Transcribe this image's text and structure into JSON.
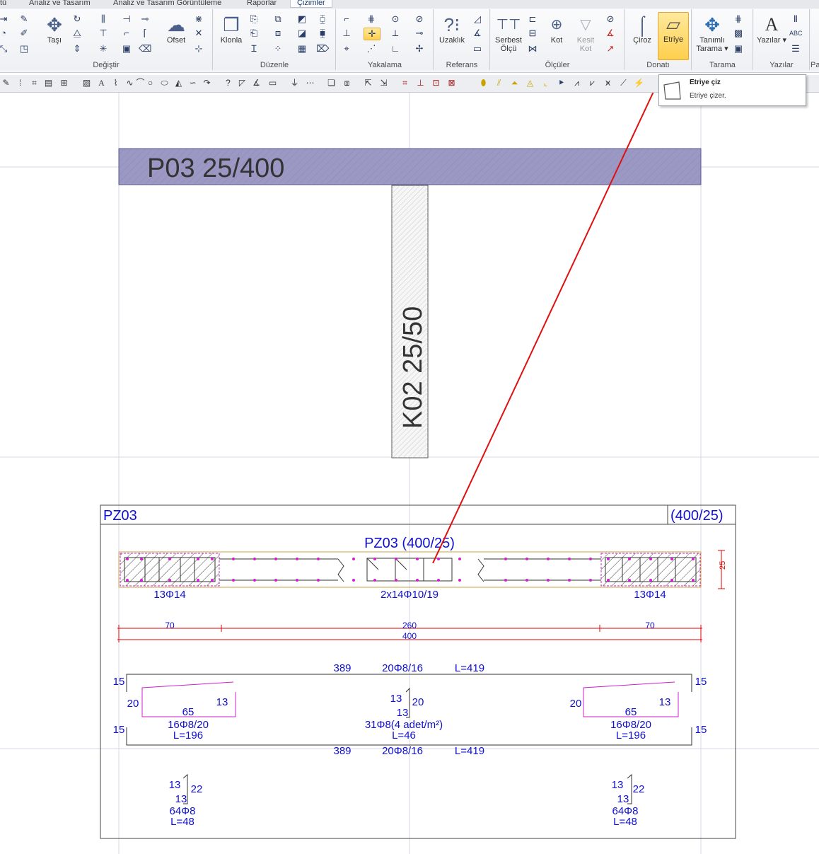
{
  "ribbon": {
    "tabs": [
      "tü",
      "Analiz ve Tasarım",
      "Analiz ve Tasarım Görüntüleme",
      "Raporlar",
      "Çizimler"
    ],
    "groups": {
      "degistir": "Değiştir",
      "duzenle": "Düzenle",
      "yakalama": "Yakalama",
      "referans": "Referans",
      "olculer": "Ölçüler",
      "donati": "Donatı",
      "tarama": "Tarama",
      "yazilar": "Yazılar",
      "pa": "Pa"
    },
    "buttons": {
      "tasi": "Taşı",
      "ofset": "Ofset",
      "klonla": "Klonla",
      "uzaklik": "Uzaklık",
      "serbest_olcu_1": "Serbest",
      "serbest_olcu_2": "Ölçü",
      "kot": "Kot",
      "kesit_kot_1": "Kesit",
      "kesit_kot_2": "Kot",
      "ciroz": "Çiroz",
      "etriye": "Etriye",
      "tanimli_tarama_1": "Tanımlı",
      "tanimli_tarama_2": "Tarama",
      "yazilar": "Yazılar"
    }
  },
  "tooltip": {
    "title": "Etriye çiz",
    "description": "Etriye çizer."
  },
  "drawing": {
    "beam_label": "P03 25/400",
    "column_label": "K02 25/50",
    "panel": {
      "name": "PZ03",
      "size": "(400/25)",
      "section_title": "PZ03 (400/25)",
      "left_bars": "13Φ14",
      "center_stirrups": "2x14Φ10/19",
      "right_bars": "13Φ14",
      "height_dim": "25",
      "dims": {
        "left": "70",
        "mid": "260",
        "right": "70",
        "total": "400"
      },
      "top_bar": {
        "length": "389",
        "spec": "20Φ8/16",
        "L": "L=419"
      },
      "bottom_bar": {
        "length": "389",
        "spec": "20Φ8/16",
        "L": "L=419"
      },
      "hooks": {
        "tl": "15",
        "tr": "15",
        "bl": "15",
        "br": "15"
      },
      "left_u": {
        "a": "20",
        "b": "13",
        "c": "65",
        "spec": "16Φ8/20",
        "L": "L=196"
      },
      "right_u": {
        "a": "20",
        "b": "13",
        "c": "65",
        "spec": "16Φ8/20",
        "L": "L=196"
      },
      "tie": {
        "a": "13",
        "b": "20",
        "c": "13",
        "spec": "31Φ8(4 adet/m²)",
        "L": "L=46"
      },
      "left_tie": {
        "a": "13",
        "b": "22",
        "c": "13",
        "spec": "64Φ8",
        "L": "L=48"
      },
      "right_tie": {
        "a": "13",
        "b": "22",
        "c": "13",
        "spec": "64Φ8",
        "L": "L=48"
      }
    }
  },
  "colors": {
    "beam_fill": "#9b99c4",
    "annotation_blue": "#1010d0",
    "dimension_red": "#e00000",
    "stirrup_magenta": "#d020d0",
    "arrow_red": "#e01010",
    "highlight": "#ffd966"
  }
}
